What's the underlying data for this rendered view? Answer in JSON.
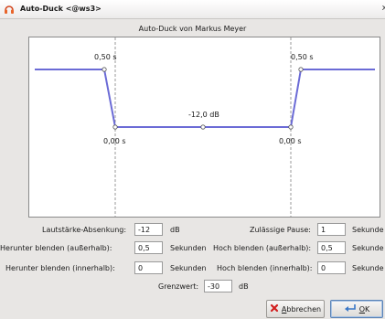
{
  "window": {
    "title": "Auto-Duck <@ws3>",
    "close_glyph": "x",
    "icon": "headphones-icon"
  },
  "subtitle": "Auto-Duck von Markus Meyer",
  "graph": {
    "label_fade_down_outer": "0,50 s",
    "label_fade_up_outer": "0,50 s",
    "label_fade_down_inner": "0,00 s",
    "label_fade_up_inner": "0,00 s",
    "label_duck_amount": "-12,0 dB",
    "line_color": "#6b6bd6"
  },
  "fields": {
    "duck_amount": {
      "label": "Lautstärke-Absenkung:",
      "value": "-12",
      "unit": "dB"
    },
    "max_pause": {
      "label": "Zulässige Pause:",
      "value": "1",
      "unit": "Sekunde"
    },
    "outer_fade_down": {
      "label": "Herunter blenden (außerhalb):",
      "value": "0,5",
      "unit": "Sekunden"
    },
    "outer_fade_up": {
      "label": "Hoch blenden (außerhalb):",
      "value": "0,5",
      "unit": "Sekunde"
    },
    "inner_fade_down": {
      "label": "Herunter blenden (innerhalb):",
      "value": "0",
      "unit": "Sekunden"
    },
    "inner_fade_up": {
      "label": "Hoch blenden (innerhalb):",
      "value": "0",
      "unit": "Sekunde"
    },
    "threshold": {
      "label": "Grenzwert:",
      "value": "-30",
      "unit": "dB"
    }
  },
  "buttons": {
    "cancel": {
      "mnemonic": "A",
      "rest": "bbrechen",
      "icon": "cancel-icon"
    },
    "ok": {
      "mnemonic": "O",
      "rest": "K",
      "icon": "ok-icon"
    }
  }
}
